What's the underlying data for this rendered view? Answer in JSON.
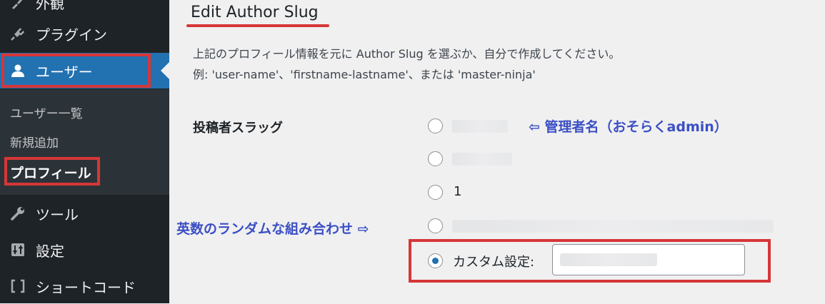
{
  "sidebar": {
    "items": [
      {
        "label": "外観",
        "icon": "brush-icon"
      },
      {
        "label": "プラグイン",
        "icon": "plugin-icon"
      },
      {
        "label": "ユーザー",
        "icon": "user-icon"
      },
      {
        "label": "ツール",
        "icon": "wrench-icon"
      },
      {
        "label": "設定",
        "icon": "settings-icon"
      },
      {
        "label": "ショートコード",
        "icon": "brackets-icon"
      }
    ],
    "submenu": [
      {
        "label": "ユーザー一覧"
      },
      {
        "label": "新規追加"
      },
      {
        "label": "プロフィール"
      }
    ]
  },
  "section": {
    "title": "Edit Author Slug",
    "desc_line1": "上記のプロフィール情報を元に Author Slug を選ぶか、自分で作成してください。",
    "desc_line2": "例: 'user-name'、'firstname-lastname'、または 'master-ninja'"
  },
  "field": {
    "label": "投稿者スラッグ",
    "options": [
      {
        "text": "",
        "checked": false
      },
      {
        "text": "",
        "checked": false
      },
      {
        "text": "1",
        "checked": false
      },
      {
        "text": "",
        "checked": false
      },
      {
        "text": "カスタム設定:",
        "checked": true
      }
    ],
    "custom_value": ""
  },
  "annotations": {
    "admin_note": "⇦ 管理者名（おそらくadmin）",
    "random_note": "英数のランダムな組み合わせ ⇨"
  },
  "colors": {
    "sidebar_bg": "#1d2327",
    "accent": "#2271b1",
    "highlight_red": "#d63638",
    "annotation_blue": "#3b4fc4"
  }
}
